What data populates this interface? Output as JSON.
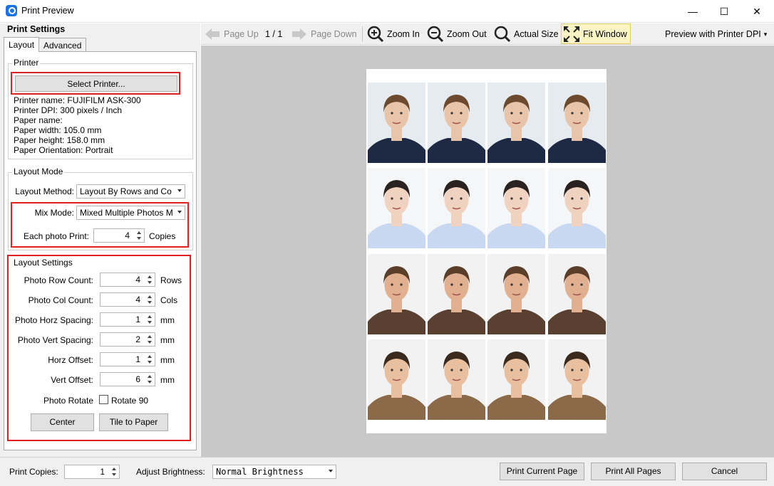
{
  "window": {
    "title": "Print Preview",
    "minimize": "—",
    "maximize": "☐",
    "close": "✕"
  },
  "left": {
    "panel_title": "Print Settings",
    "tabs": [
      "Layout",
      "Advanced"
    ],
    "printer_group": "Printer",
    "select_printer": "Select Printer...",
    "info": [
      "Printer name: FUJIFILM ASK-300",
      "Printer DPI: 300 pixels / Inch",
      "Paper name:",
      "Paper width: 105.0 mm",
      "Paper height: 158.0 mm",
      "Paper Orientation: Portrait"
    ],
    "layout_mode": {
      "group": "Layout Mode",
      "method_label": "Layout Method:",
      "method_value": "Layout By Rows and Co",
      "mix_label": "Mix Mode:",
      "mix_value": "Mixed Multiple Photos M",
      "each_label": "Each photo Print:",
      "each_value": "4",
      "each_unit": "Copies"
    },
    "layout_settings": {
      "group": "Layout Settings",
      "rows": [
        {
          "label": "Photo Row Count:",
          "value": "4",
          "unit": "Rows"
        },
        {
          "label": "Photo Col Count:",
          "value": "4",
          "unit": "Cols"
        },
        {
          "label": "Photo Horz Spacing:",
          "value": "1",
          "unit": "mm"
        },
        {
          "label": "Photo Vert Spacing:",
          "value": "2",
          "unit": "mm"
        },
        {
          "label": "Horz Offset:",
          "value": "1",
          "unit": "mm"
        },
        {
          "label": "Vert Offset:",
          "value": "6",
          "unit": "mm"
        }
      ],
      "rotate_label": "Photo Rotate",
      "rotate_check": "Rotate 90",
      "rotate_checked": false,
      "center": "Center",
      "tile": "Tile to Paper"
    }
  },
  "toolbar": {
    "page_up": "Page Up",
    "page_indicator": "1 / 1",
    "page_down": "Page Down",
    "zoom_in": "Zoom In",
    "zoom_out": "Zoom Out",
    "actual_size": "Actual Size",
    "fit_window": "Fit Window",
    "preview_dpi": "Preview with Printer DPI"
  },
  "bottom": {
    "copies_label": "Print Copies:",
    "copies_value": "1",
    "brightness_label": "Adjust Brightness:",
    "brightness_value": "Normal Brightness",
    "print_current": "Print Current Page",
    "print_all": "Print All Pages",
    "cancel": "Cancel"
  },
  "colors": {
    "highlight_border": "#e02020",
    "fit_window_bg": "#fdf4c5"
  },
  "photo_rows": [
    {
      "person": "woman-bowtie",
      "skin": "#e8c4a8",
      "hair": "#6b4a2e",
      "clothes": "#1e2a44",
      "bg": "#e6ebf0"
    },
    {
      "person": "woman-blouse",
      "skin": "#f0d2c0",
      "hair": "#2a2220",
      "clothes": "#c8d8f0",
      "bg": "#f4f6f8"
    },
    {
      "person": "man-beard",
      "skin": "#e0b090",
      "hair": "#5a3e2a",
      "clothes": "#5a4030",
      "bg": "#f2f2f2"
    },
    {
      "person": "man-suit-brown",
      "skin": "#e8c0a0",
      "hair": "#3a2a1e",
      "clothes": "#8a6a48",
      "bg": "#f2f2f2"
    }
  ]
}
